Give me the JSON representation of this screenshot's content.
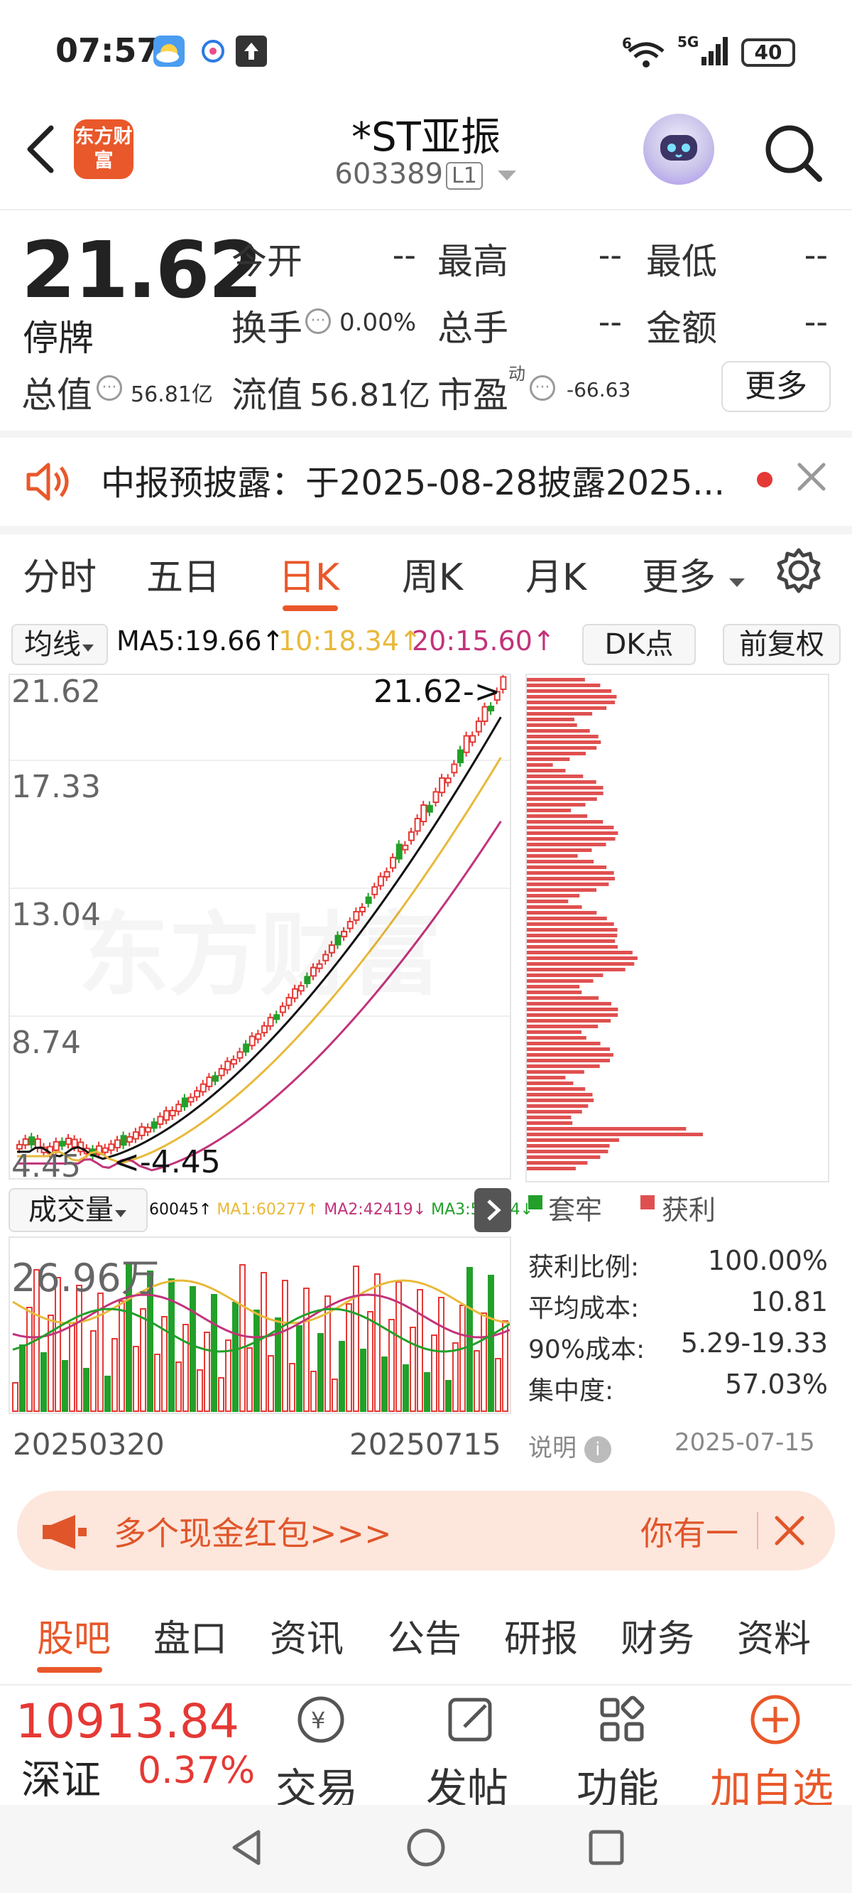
{
  "status_bar": {
    "time": "07:57",
    "battery": "40",
    "icons": [
      "weather-icon",
      "satellite-app-icon",
      "upload-icon",
      "wifi-6-icon",
      "5g-signal-icon",
      "battery-icon"
    ]
  },
  "header": {
    "logo": "东方财富",
    "stock_name": "*ST亚振",
    "stock_code": "603389",
    "level": "L1"
  },
  "quote": {
    "price": "21.62",
    "status": "停牌",
    "rows": [
      [
        {
          "label": "今开",
          "value": "--"
        },
        {
          "label": "最高",
          "value": "--"
        },
        {
          "label": "最低",
          "value": "--"
        }
      ],
      [
        {
          "label": "换手",
          "value": "0.00%"
        },
        {
          "label": "总手",
          "value": "--"
        },
        {
          "label": "金额",
          "value": "--"
        }
      ]
    ],
    "total_value_label": "总值",
    "total_value": "56.81亿",
    "float_value_label": "流值",
    "float_value": "56.81亿",
    "pe_label": "市盈",
    "pe_superscript": "动",
    "pe_value": "-66.63",
    "more_label": "更多"
  },
  "notice": {
    "text": "中报预披露：于2025-08-28披露2025..."
  },
  "chart_tabs": [
    "分时",
    "五日",
    "日K",
    "周K",
    "月K",
    "更多"
  ],
  "active_tab": "日K",
  "ma_bar": {
    "dropdown": "均线",
    "ma5": "MA5:19.66↑",
    "ma10": "10:18.34↑",
    "ma20": "20:15.60↑",
    "dk_label": "DK点",
    "adjust_label": "前复权"
  },
  "kline": {
    "y_labels": [
      "21.62",
      "17.33",
      "13.04",
      "8.74",
      "4.45"
    ],
    "high_marker": "21.62->",
    "low_marker": "<-4.45",
    "watermark": "东方财富"
  },
  "volume": {
    "dropdown": "成交量",
    "legend": {
      "vol": "60045↑",
      "ma1": "MA1:60277↑",
      "ma2": "MA2:42419↓",
      "ma3": "MA3:56754↓"
    },
    "max_label": "26.96万",
    "start_date": "20250320",
    "end_date": "20250715"
  },
  "chip": {
    "legend_trapped": "套牢",
    "legend_profit": "获利",
    "stats": [
      {
        "label": "获利比例:",
        "value": "100.00%"
      },
      {
        "label": "平均成本:",
        "value": "10.81"
      },
      {
        "label": "90%成本:",
        "value": "5.29-19.33"
      },
      {
        "label": "集中度:",
        "value": "57.03%"
      }
    ],
    "note_label": "说明",
    "date": "2025-07-15"
  },
  "banner": {
    "text": "多个现金红包>>>",
    "right_text": "你有一"
  },
  "bottom_tabs": [
    "股吧",
    "盘口",
    "资讯",
    "公告",
    "研报",
    "财务",
    "资料"
  ],
  "footer": {
    "index_value": "10913.84",
    "index_name": "深证",
    "index_pct": "0.37%",
    "buttons": [
      "交易",
      "发帖",
      "功能",
      "加自选"
    ]
  },
  "colors": {
    "accent": "#e9582a",
    "up": "#e53935",
    "down": "#22a02a",
    "ma5": "#111111",
    "ma10": "#e8b93a",
    "ma20": "#c2337a"
  }
}
